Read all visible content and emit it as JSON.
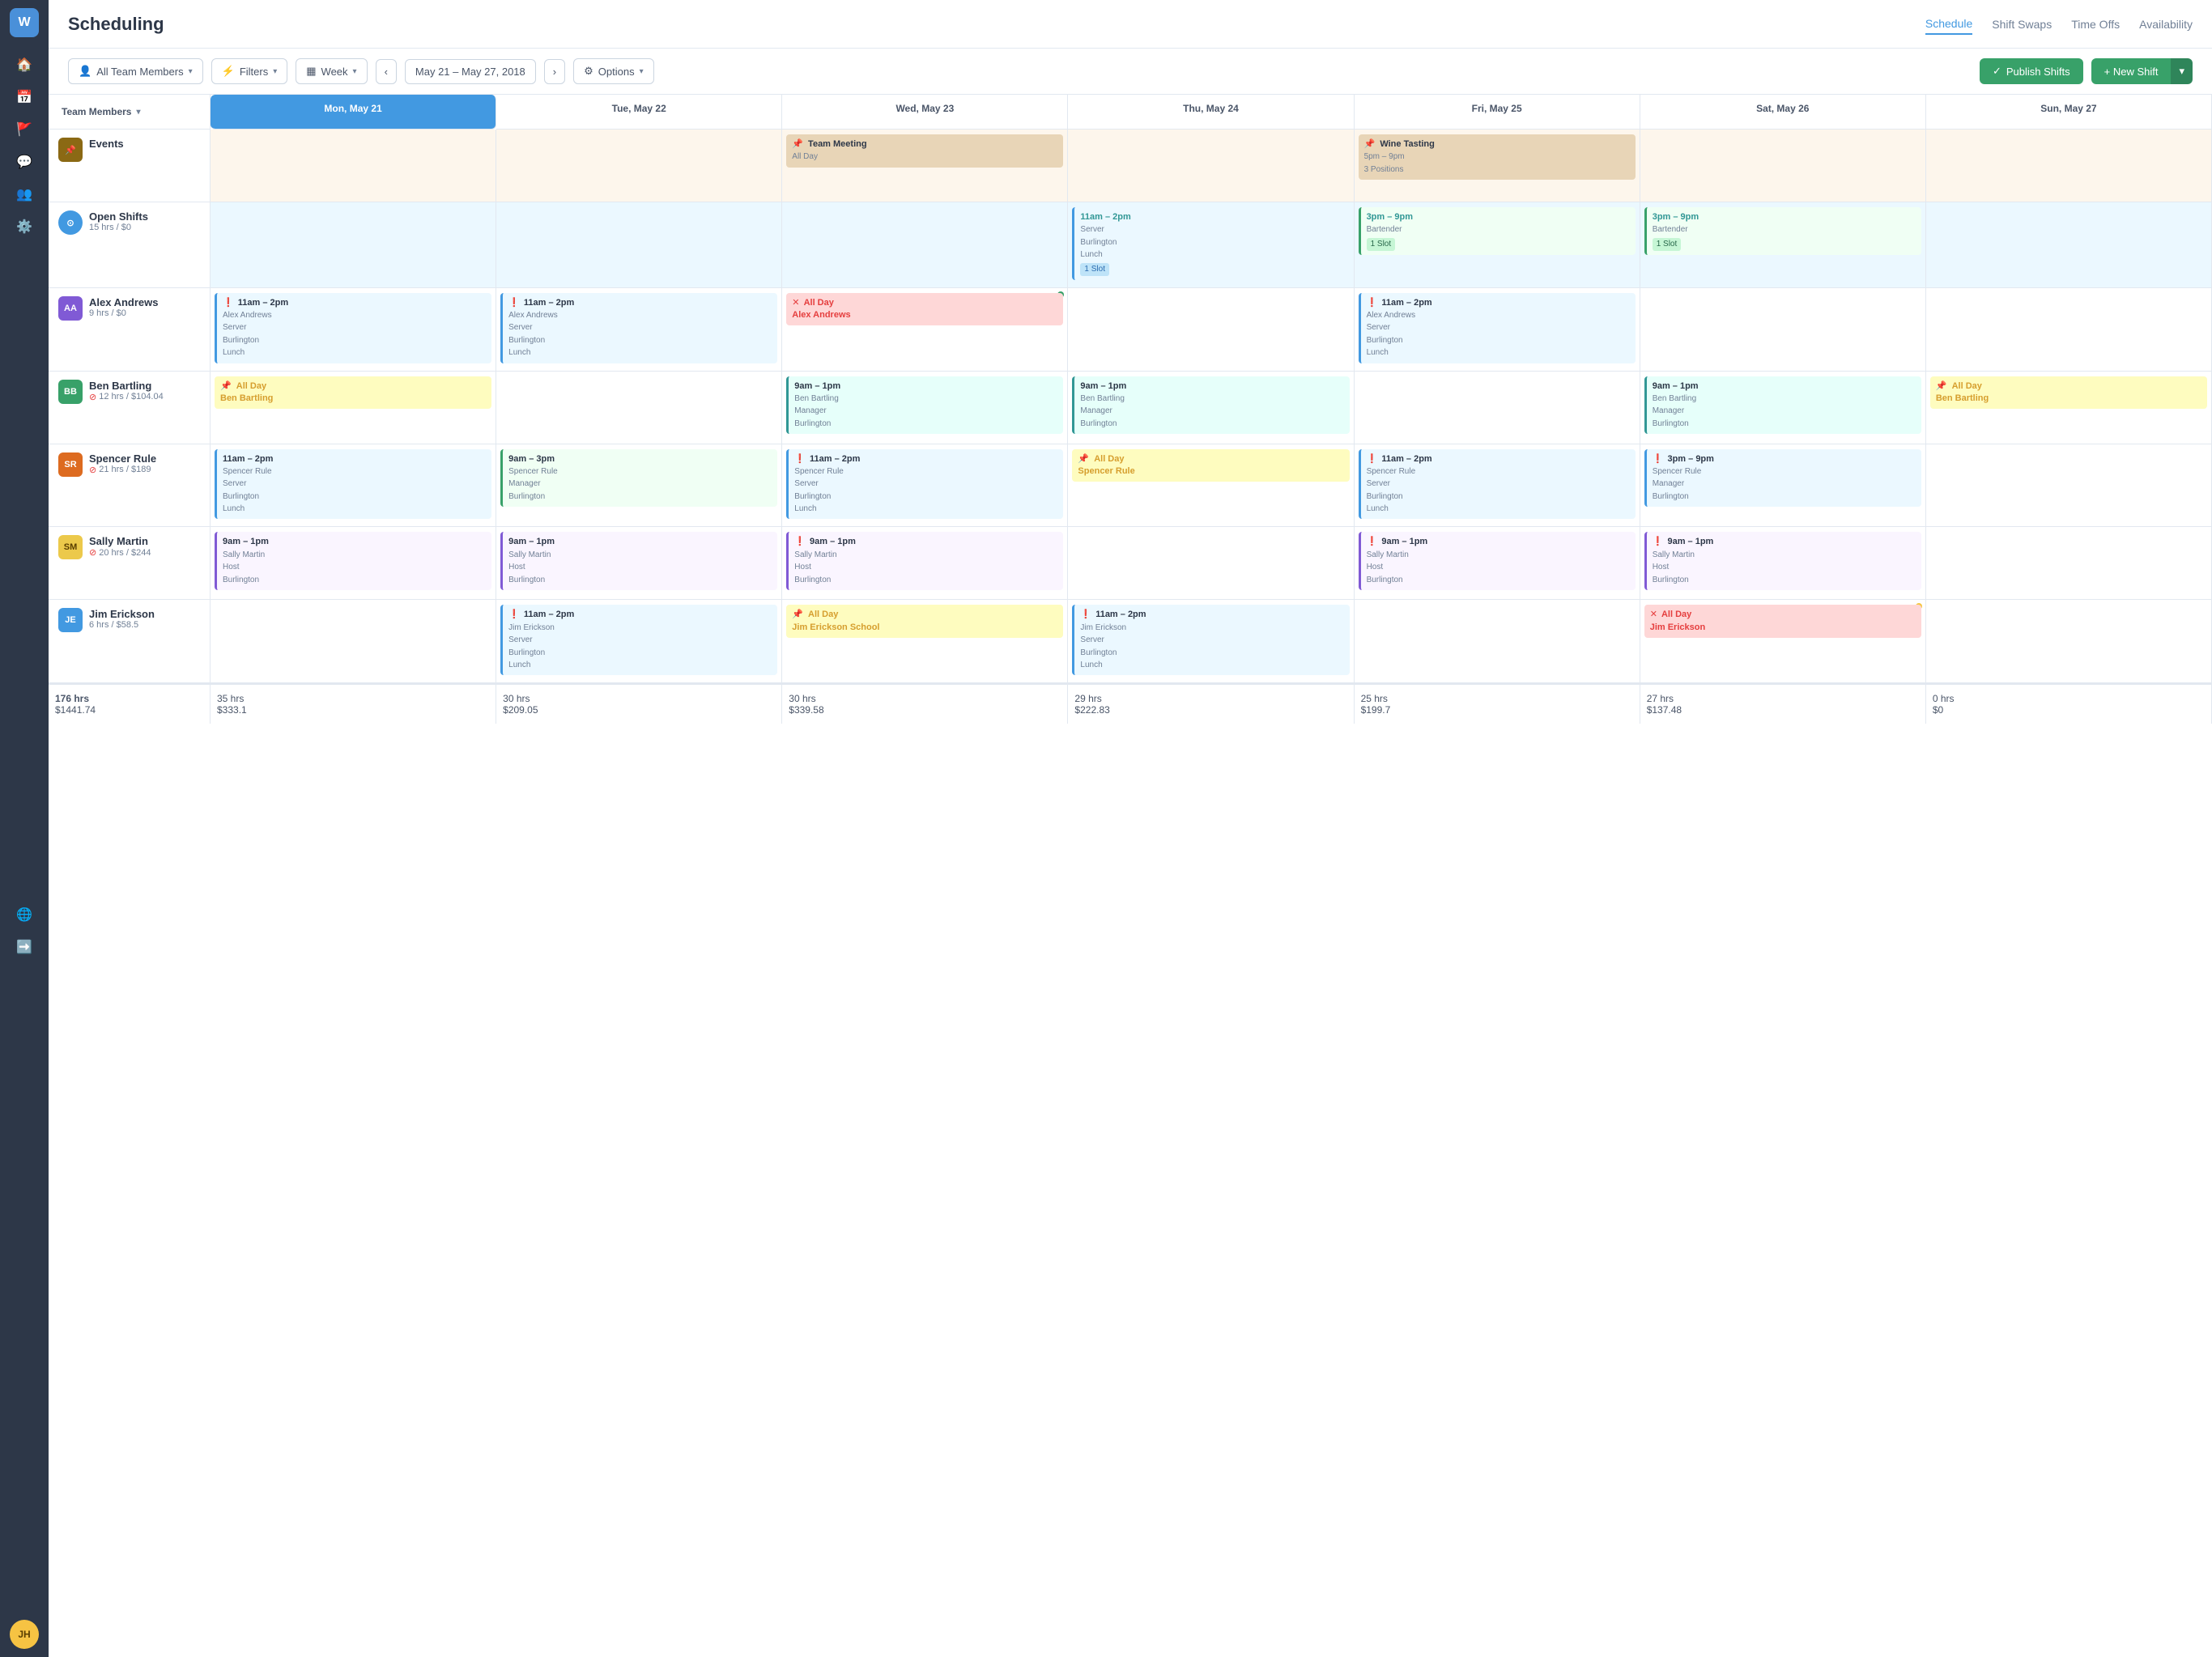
{
  "app": {
    "logo": "W",
    "title": "Scheduling"
  },
  "nav": {
    "items": [
      {
        "id": "schedule",
        "label": "Schedule",
        "active": true
      },
      {
        "id": "shift-swaps",
        "label": "Shift Swaps",
        "active": false
      },
      {
        "id": "time-offs",
        "label": "Time Offs",
        "active": false
      },
      {
        "id": "availability",
        "label": "Availability",
        "active": false
      }
    ]
  },
  "toolbar": {
    "team_members_label": "All Team Members",
    "filters_label": "Filters",
    "week_label": "Week",
    "date_range": "May 21 – May 27, 2018",
    "options_label": "Options",
    "publish_label": "Publish Shifts",
    "new_shift_label": "+ New Shift"
  },
  "calendar": {
    "row_label": "Team Members",
    "days": [
      {
        "id": "mon",
        "label": "Mon, May 21",
        "today": true
      },
      {
        "id": "tue",
        "label": "Tue, May 22",
        "today": false
      },
      {
        "id": "wed",
        "label": "Wed, May 23",
        "today": false
      },
      {
        "id": "thu",
        "label": "Thu, May 24",
        "today": false
      },
      {
        "id": "fri",
        "label": "Fri, May 25",
        "today": false
      },
      {
        "id": "sat",
        "label": "Sat, May 26",
        "today": false
      },
      {
        "id": "sun",
        "label": "Sun, May 27",
        "today": false
      }
    ],
    "rows": [
      {
        "id": "events",
        "type": "events",
        "label": "Events",
        "avatar_color": "#8b6914",
        "avatar_text": "📌",
        "cells": [
          {
            "day": "mon",
            "shifts": []
          },
          {
            "day": "tue",
            "shifts": []
          },
          {
            "day": "wed",
            "shifts": [
              {
                "type": "event-tan",
                "time": "Team Meeting",
                "name": "All Day",
                "pin": true
              }
            ]
          },
          {
            "day": "thu",
            "shifts": []
          },
          {
            "day": "fri",
            "shifts": [
              {
                "type": "event-tan",
                "time": "Wine Tasting",
                "name": "5pm – 9pm",
                "sub": "3 Positions",
                "pin": true
              }
            ]
          },
          {
            "day": "sat",
            "shifts": []
          },
          {
            "day": "sun",
            "shifts": []
          }
        ]
      },
      {
        "id": "open-shifts",
        "type": "open",
        "label": "Open Shifts",
        "sub": "15 hrs / $0",
        "avatar_color": "#4299e1",
        "avatar_text": "⊙",
        "cells": [
          {
            "day": "mon",
            "shifts": []
          },
          {
            "day": "tue",
            "shifts": []
          },
          {
            "day": "wed",
            "shifts": []
          },
          {
            "day": "thu",
            "shifts": [
              {
                "type": "blue-border",
                "time": "11am – 2pm",
                "role": "Server",
                "loc": "Burlington",
                "sub2": "Lunch",
                "slot": "1 Slot",
                "slot_color": "blue"
              }
            ]
          },
          {
            "day": "fri",
            "shifts": [
              {
                "type": "green-border",
                "time": "3pm – 9pm",
                "role": "Bartender",
                "slot": "1 Slot",
                "slot_color": "green"
              }
            ]
          },
          {
            "day": "sat",
            "shifts": [
              {
                "type": "green-border",
                "time": "3pm – 9pm",
                "role": "Bartender",
                "slot": "1 Slot",
                "slot_color": "green"
              }
            ]
          },
          {
            "day": "sun",
            "shifts": []
          }
        ]
      },
      {
        "id": "alex-andrews",
        "label": "Alex Andrews",
        "sub": "9 hrs / $0",
        "avatar_color": "#805ad5",
        "avatar_initials": "AA",
        "cells": [
          {
            "day": "mon",
            "shifts": [
              {
                "type": "blue-border",
                "exclaim": true,
                "time": "11am – 2pm",
                "name": "Alex Andrews",
                "role": "Server",
                "loc": "Burlington",
                "sub2": "Lunch"
              }
            ]
          },
          {
            "day": "tue",
            "shifts": [
              {
                "type": "blue-border",
                "exclaim": true,
                "time": "11am – 2pm",
                "name": "Alex Andrews",
                "role": "Server",
                "loc": "Burlington",
                "sub2": "Lunch"
              }
            ]
          },
          {
            "day": "wed",
            "shifts": [
              {
                "type": "allday-red",
                "x_icon": true,
                "time": "All Day",
                "name": "Alex Andrews",
                "dot": true
              }
            ]
          },
          {
            "day": "thu",
            "shifts": []
          },
          {
            "day": "fri",
            "shifts": [
              {
                "type": "blue-border",
                "exclaim": true,
                "time": "11am – 2pm",
                "name": "Alex Andrews",
                "role": "Server",
                "loc": "Burlington",
                "sub2": "Lunch"
              }
            ]
          },
          {
            "day": "sat",
            "shifts": []
          },
          {
            "day": "sun",
            "shifts": []
          }
        ]
      },
      {
        "id": "ben-bartling",
        "label": "Ben Bartling",
        "sub": "12 hrs / $104.04",
        "warn": true,
        "avatar_color": "#38a169",
        "avatar_initials": "BB",
        "cells": [
          {
            "day": "mon",
            "shifts": [
              {
                "type": "allday-yellow",
                "time": "All Day",
                "name": "Ben Bartling",
                "pin": true
              }
            ]
          },
          {
            "day": "tue",
            "shifts": []
          },
          {
            "day": "wed",
            "shifts": [
              {
                "type": "teal-border",
                "time": "9am – 1pm",
                "name": "Ben Bartling",
                "role": "Manager",
                "loc": "Burlington"
              }
            ]
          },
          {
            "day": "thu",
            "shifts": [
              {
                "type": "teal-border",
                "time": "9am – 1pm",
                "name": "Ben Bartling",
                "role": "Manager",
                "loc": "Burlington"
              }
            ]
          },
          {
            "day": "fri",
            "shifts": []
          },
          {
            "day": "sat",
            "shifts": [
              {
                "type": "teal-border",
                "time": "9am – 1pm",
                "name": "Ben Bartling",
                "role": "Manager",
                "loc": "Burlington"
              }
            ]
          },
          {
            "day": "sun",
            "shifts": [
              {
                "type": "allday-yellow",
                "time": "All Day",
                "name": "Ben Bartling",
                "pin": true
              }
            ]
          }
        ]
      },
      {
        "id": "spencer-rule",
        "label": "Spencer Rule",
        "sub": "21 hrs / $189",
        "warn": true,
        "avatar_color": "#dd6b20",
        "avatar_initials": "SR",
        "cells": [
          {
            "day": "mon",
            "shifts": [
              {
                "type": "blue-border",
                "time": "11am – 2pm",
                "name": "Spencer Rule",
                "role": "Server",
                "loc": "Burlington",
                "sub2": "Lunch"
              }
            ]
          },
          {
            "day": "tue",
            "shifts": [
              {
                "type": "green-border",
                "time": "9am – 3pm",
                "name": "Spencer Rule",
                "role": "Manager",
                "loc": "Burlington"
              }
            ]
          },
          {
            "day": "wed",
            "shifts": [
              {
                "type": "blue-border",
                "exclaim": true,
                "time": "11am – 2pm",
                "name": "Spencer Rule",
                "role": "Server",
                "loc": "Burlington",
                "sub2": "Lunch"
              }
            ]
          },
          {
            "day": "thu",
            "shifts": [
              {
                "type": "allday-yellow",
                "pin": true,
                "time": "All Day",
                "name": "Spencer Rule"
              }
            ]
          },
          {
            "day": "fri",
            "shifts": [
              {
                "type": "blue-border",
                "exclaim": true,
                "time": "11am – 2pm",
                "name": "Spencer Rule",
                "role": "Server",
                "loc": "Burlington",
                "sub2": "Lunch"
              }
            ]
          },
          {
            "day": "sat",
            "shifts": [
              {
                "type": "blue-border",
                "exclaim": true,
                "time": "3pm – 9pm",
                "name": "Spencer Rule",
                "role": "Manager",
                "loc": "Burlington"
              }
            ]
          },
          {
            "day": "sun",
            "shifts": []
          }
        ]
      },
      {
        "id": "sally-martin",
        "label": "Sally Martin",
        "sub": "20 hrs / $244",
        "warn": true,
        "avatar_color": "#ecc94b",
        "avatar_initials": "SM",
        "avatar_text_color": "#5a3e00",
        "cells": [
          {
            "day": "mon",
            "shifts": [
              {
                "type": "purple-border",
                "time": "9am – 1pm",
                "name": "Sally Martin",
                "role": "Host",
                "loc": "Burlington"
              }
            ]
          },
          {
            "day": "tue",
            "shifts": [
              {
                "type": "purple-border",
                "time": "9am – 1pm",
                "name": "Sally Martin",
                "role": "Host",
                "loc": "Burlington"
              }
            ]
          },
          {
            "day": "wed",
            "shifts": [
              {
                "type": "purple-border",
                "exclaim": true,
                "time": "9am – 1pm",
                "name": "Sally Martin",
                "role": "Host",
                "loc": "Burlington"
              }
            ]
          },
          {
            "day": "thu",
            "shifts": []
          },
          {
            "day": "fri",
            "shifts": [
              {
                "type": "purple-border",
                "exclaim": true,
                "time": "9am – 1pm",
                "name": "Sally Martin",
                "role": "Host",
                "loc": "Burlington"
              }
            ]
          },
          {
            "day": "sat",
            "shifts": [
              {
                "type": "purple-border",
                "exclaim": true,
                "time": "9am – 1pm",
                "name": "Sally Martin",
                "role": "Host",
                "loc": "Burlington"
              }
            ]
          },
          {
            "day": "sun",
            "shifts": []
          }
        ]
      },
      {
        "id": "jim-erickson",
        "label": "Jim Erickson",
        "sub": "6 hrs / $58.5",
        "avatar_color": "#4299e1",
        "avatar_initials": "JE",
        "cells": [
          {
            "day": "mon",
            "shifts": []
          },
          {
            "day": "tue",
            "shifts": [
              {
                "type": "blue-border",
                "exclaim": true,
                "time": "11am – 2pm",
                "name": "Jim Erickson",
                "role": "Server",
                "loc": "Burlington",
                "sub2": "Lunch"
              }
            ]
          },
          {
            "day": "wed",
            "shifts": [
              {
                "type": "allday-yellow",
                "pin": true,
                "time": "All Day",
                "name": "Jim Erickson School"
              }
            ]
          },
          {
            "day": "thu",
            "shifts": [
              {
                "type": "blue-border",
                "exclaim": true,
                "time": "11am – 2pm",
                "name": "Jim Erickson",
                "role": "Server",
                "loc": "Burlington",
                "sub2": "Lunch"
              }
            ]
          },
          {
            "day": "fri",
            "shifts": []
          },
          {
            "day": "sat",
            "shifts": [
              {
                "type": "allday-pink",
                "x_icon": true,
                "time": "All Day",
                "name": "Jim Erickson",
                "dot_yellow": true
              }
            ]
          },
          {
            "day": "sun",
            "shifts": []
          }
        ]
      }
    ],
    "totals": {
      "label": "176 hrs\n$1441.74",
      "days": [
        {
          "top": "35 hrs",
          "bottom": "$333.1"
        },
        {
          "top": "30 hrs",
          "bottom": "$209.05"
        },
        {
          "top": "30 hrs",
          "bottom": "$339.58"
        },
        {
          "top": "29 hrs",
          "bottom": "$222.83"
        },
        {
          "top": "25 hrs",
          "bottom": "$199.7"
        },
        {
          "top": "27 hrs",
          "bottom": "$137.48"
        },
        {
          "top": "0 hrs",
          "bottom": "$0"
        }
      ]
    }
  }
}
